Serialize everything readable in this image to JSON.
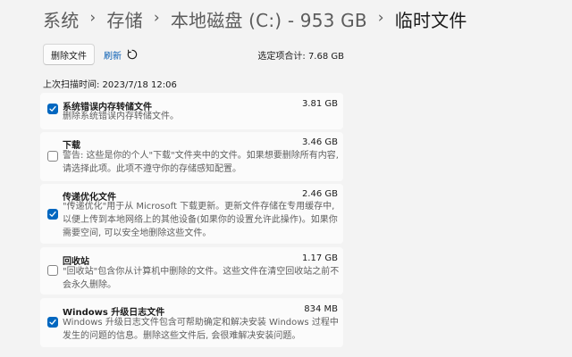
{
  "breadcrumb": {
    "items": [
      "系统",
      "存储",
      "本地磁盘 (C:) - 953 GB"
    ],
    "separator": "›",
    "current": "临时文件"
  },
  "toolbar": {
    "delete_label": "删除文件",
    "refresh_label": "刷新",
    "refresh_icon": "refresh-icon",
    "selected_total": "选定项合计: 7.68 GB"
  },
  "last_scan": "上次扫描时间: 2023/7/18 12:06",
  "items": [
    {
      "title": "系统错误内存转储文件",
      "size": "3.81 GB",
      "checked": true,
      "description": "删除系统错误内存转储文件。"
    },
    {
      "title": "下载",
      "size": "3.46 GB",
      "checked": false,
      "description": "警告: 这些是你的个人\"下载\"文件夹中的文件。如果想要删除所有内容, 请选择此项。此项不遵守你的存储感知配置。"
    },
    {
      "title": "传递优化文件",
      "size": "2.46 GB",
      "checked": true,
      "description": "\"传递优化\"用于从 Microsoft 下载更新。更新文件存储在专用缓存中, 以便上传到本地网络上的其他设备(如果你的设置允许此操作)。如果你需要空间, 可以安全地删除这些文件。"
    },
    {
      "title": "回收站",
      "size": "1.17 GB",
      "checked": false,
      "description": "\"回收站\"包含你从计算机中删除的文件。这些文件在清空回收站之前不会永久删除。"
    },
    {
      "title": "Windows 升级日志文件",
      "size": "834 MB",
      "checked": true,
      "description": "Windows 升级日志文件包含可帮助确定和解决安装 Windows 过程中发生的问题的信息。删除这些文件后, 会很难解决安装问题。"
    }
  ],
  "colors": {
    "accent": "#0067c0",
    "link": "#0a5fb4",
    "background": "#f3f3f3",
    "card": "#fbfbfb"
  }
}
